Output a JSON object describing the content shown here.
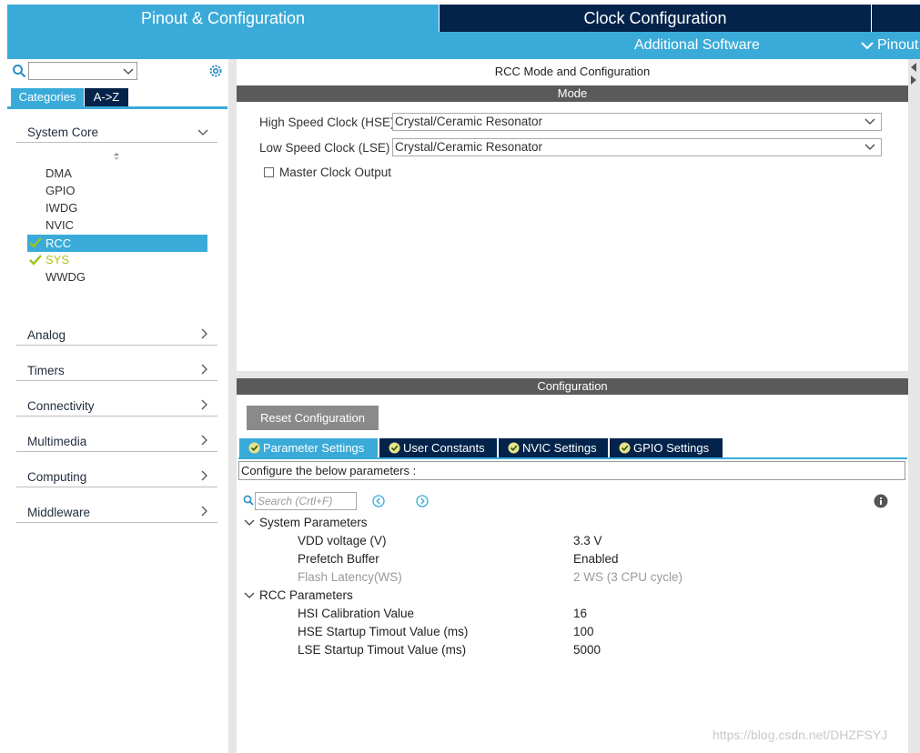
{
  "tabs": {
    "pinout": "Pinout & Configuration",
    "clock": "Clock Configuration",
    "additional": "Additional Software",
    "pinout_view": "Pinout"
  },
  "left": {
    "categories_tab": "Categories",
    "az_tab": "A->Z",
    "groups": {
      "system_core": "System Core",
      "analog": "Analog",
      "timers": "Timers",
      "connectivity": "Connectivity",
      "multimedia": "Multimedia",
      "computing": "Computing",
      "middleware": "Middleware"
    },
    "peripherals": [
      "DMA",
      "GPIO",
      "IWDG",
      "NVIC",
      "RCC",
      "SYS",
      "WWDG"
    ]
  },
  "mode": {
    "title": "RCC Mode and Configuration",
    "section": "Mode",
    "hse_label": "High Speed Clock (HSE)",
    "hse_value": "Crystal/Ceramic Resonator",
    "lse_label": "Low Speed Clock (LSE)",
    "lse_value": "Crystal/Ceramic Resonator",
    "mco_label": "Master Clock Output"
  },
  "config": {
    "section": "Configuration",
    "reset_button": "Reset Configuration",
    "tabs": [
      "Parameter Settings",
      "User Constants",
      "NVIC Settings",
      "GPIO Settings"
    ],
    "configure_text": "Configure the below parameters :",
    "search_placeholder": "Search (Crtl+F)",
    "system_group": "System Parameters",
    "system_params": [
      {
        "name": "VDD voltage (V)",
        "value": "3.3 V"
      },
      {
        "name": "Prefetch Buffer",
        "value": "Enabled"
      },
      {
        "name": "Flash Latency(WS)",
        "value": "2 WS (3 CPU cycle)"
      }
    ],
    "rcc_group": "RCC Parameters",
    "rcc_params": [
      {
        "name": "HSI Calibration Value",
        "value": "16"
      },
      {
        "name": "HSE Startup Timout Value (ms)",
        "value": "100"
      },
      {
        "name": "LSE Startup Timout Value (ms)",
        "value": "5000"
      }
    ]
  },
  "watermark": "https://blog.csdn.net/DHZFSYJ",
  "colors": {
    "accent": "#3aabd9",
    "navy": "#03234b",
    "check_green": "#9bc31c",
    "section_bar": "#5a5a5a"
  }
}
